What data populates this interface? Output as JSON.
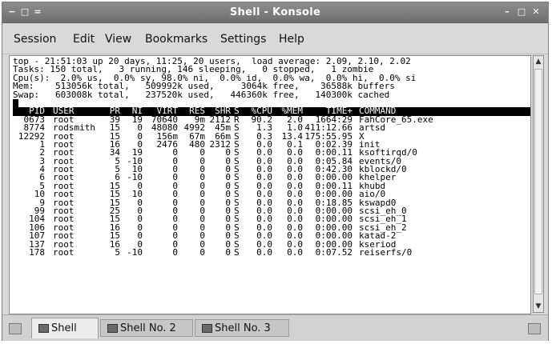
{
  "window": {
    "title": "Shell - Konsole",
    "left_buttons": [
      "−",
      "□",
      "="
    ],
    "right_buttons": [
      "–",
      "□",
      "✕"
    ]
  },
  "menu": [
    "Session",
    "Edit",
    "View",
    "Bookmarks",
    "Settings",
    "Help"
  ],
  "summary": [
    "top - 21:51:03 up 20 days, 11:25, 20 users,  load average: 2.09, 2.10, 2.02",
    "Tasks: 150 total,   3 running, 146 sleeping,   0 stopped,   1 zombie",
    "Cpu(s):  2.0% us,  0.0% sy, 98.0% ni,  0.0% id,  0.0% wa,  0.0% hi,  0.0% si",
    "Mem:    513056k total,   509992k used,     3064k free,    36588k buffers",
    "Swap:   603008k total,   237520k used,   446360k free,   140300k cached"
  ],
  "columns": [
    "PID",
    "USER",
    "PR",
    "NI",
    "VIRT",
    "RES",
    "SHR",
    "S",
    "%CPU",
    "%MEM",
    "TIME+",
    "COMMAND"
  ],
  "processes": [
    [
      "0673",
      "root",
      "39",
      "19",
      "70640",
      "9m",
      "2112",
      "R",
      "90.2",
      "2.0",
      "1664:29",
      "FahCore_65.exe"
    ],
    [
      "8774",
      "rodsmith",
      "15",
      "0",
      "48080",
      "4992",
      "45m",
      "S",
      "1.3",
      "1.0",
      "411:12.66",
      "artsd"
    ],
    [
      "12292",
      "root",
      "15",
      "0",
      "156m",
      "67m",
      "66m",
      "S",
      "0.3",
      "13.4",
      "175:55.95",
      "X"
    ],
    [
      "1",
      "root",
      "16",
      "0",
      "2476",
      "480",
      "2312",
      "S",
      "0.0",
      "0.1",
      "0:02.39",
      "init"
    ],
    [
      "2",
      "root",
      "34",
      "19",
      "0",
      "0",
      "0",
      "S",
      "0.0",
      "0.0",
      "0:00.11",
      "ksoftirqd/0"
    ],
    [
      "3",
      "root",
      "5",
      "-10",
      "0",
      "0",
      "0",
      "S",
      "0.0",
      "0.0",
      "0:05.84",
      "events/0"
    ],
    [
      "4",
      "root",
      "5",
      "10",
      "0",
      "0",
      "0",
      "S",
      "0.0",
      "0.0",
      "0:42.30",
      "kblockd/0"
    ],
    [
      "6",
      "root",
      "6",
      "-10",
      "0",
      "0",
      "0",
      "S",
      "0.0",
      "0.0",
      "0:00.00",
      "khelper"
    ],
    [
      "5",
      "root",
      "15",
      "0",
      "0",
      "0",
      "0",
      "S",
      "0.0",
      "0.0",
      "0:00.11",
      "khubd"
    ],
    [
      "10",
      "root",
      "15",
      "10",
      "0",
      "0",
      "0",
      "S",
      "0.0",
      "0.0",
      "0:00.00",
      "aio/0"
    ],
    [
      "9",
      "root",
      "15",
      "0",
      "0",
      "0",
      "0",
      "S",
      "0.0",
      "0.0",
      "0:18.85",
      "kswapd0"
    ],
    [
      "99",
      "root",
      "25",
      "0",
      "0",
      "0",
      "0",
      "S",
      "0.0",
      "0.0",
      "0:00.00",
      "scsi_eh_0"
    ],
    [
      "104",
      "root",
      "15",
      "0",
      "0",
      "0",
      "0",
      "S",
      "0.0",
      "0.0",
      "0:00.00",
      "scsi_eh_1"
    ],
    [
      "106",
      "root",
      "16",
      "0",
      "0",
      "0",
      "0",
      "S",
      "0.0",
      "0.0",
      "0:00.00",
      "scsi_eh_2"
    ],
    [
      "107",
      "root",
      "15",
      "0",
      "0",
      "0",
      "0",
      "S",
      "0.0",
      "0.0",
      "0:00.00",
      "katad-2"
    ],
    [
      "137",
      "root",
      "16",
      "0",
      "0",
      "0",
      "0",
      "S",
      "0.0",
      "0.0",
      "0:00.00",
      "kseriod"
    ],
    [
      "178",
      "root",
      "5",
      "-10",
      "0",
      "0",
      "0",
      "S",
      "0.0",
      "0.0",
      "0:07.52",
      "reiserfs/0"
    ]
  ],
  "tabs": [
    {
      "label": "Shell",
      "active": true
    },
    {
      "label": "Shell No. 2",
      "active": false
    },
    {
      "label": "Shell No. 3",
      "active": false
    }
  ],
  "icons": {
    "new_tab": "new-tab-icon",
    "close_tab": "close-tab-icon",
    "terminal": "terminal-icon"
  },
  "colors": {
    "header_bg": "#000000",
    "header_fg": "#ffffff",
    "titlebar": "#7a7a7a"
  }
}
